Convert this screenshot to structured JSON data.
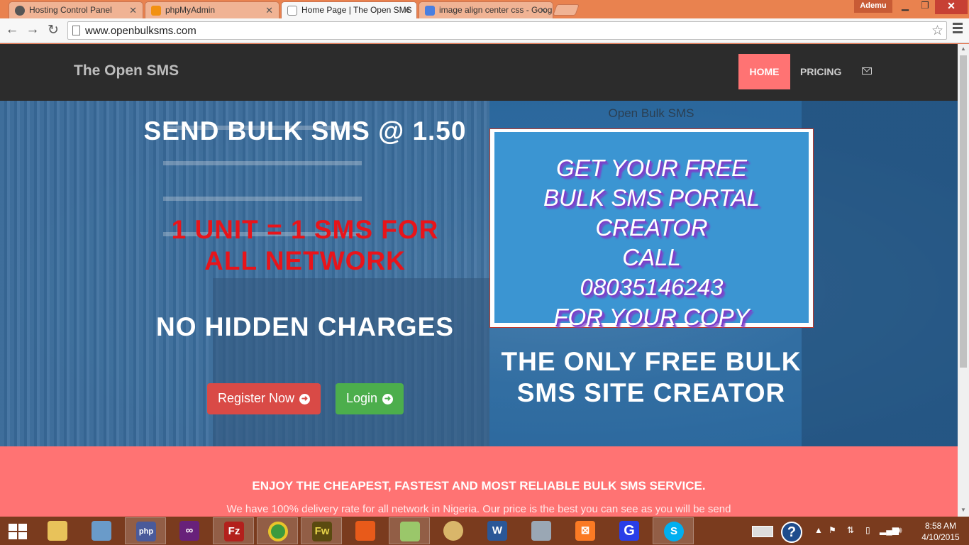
{
  "browser": {
    "tabs": [
      {
        "title": "Hosting Control Panel",
        "active": false
      },
      {
        "title": "phpMyAdmin",
        "active": false
      },
      {
        "title": "Home Page | The Open SMS",
        "active": true
      },
      {
        "title": "image align center css - Google Search",
        "active": false
      }
    ],
    "profile_name": "Ademu",
    "url": "www.openbulksms.com"
  },
  "site": {
    "brand": "The Open SMS",
    "nav": {
      "home": "HOME",
      "pricing": "PRICING"
    }
  },
  "hero": {
    "headline": "SEND BULK SMS @ 1.50",
    "unit_line": "1 UNIT = 1 SMS FOR ALL NETWORK",
    "no_hidden": "NO HIDDEN CHARGES",
    "register_label": "Register Now",
    "login_label": "Login",
    "promo_caption": "Open Bulk SMS",
    "promo_lines": [
      "GET YOUR FREE",
      "BULK SMS PORTAL CREATOR",
      "CALL",
      "08035146243",
      "FOR YOUR COPY"
    ],
    "only_free": "THE ONLY FREE BULK SMS SITE CREATOR"
  },
  "features": {
    "heading": "ENJOY THE CHEAPEST, FASTEST AND MOST RELIABLE BULK SMS SERVICE.",
    "text": "We have 100% delivery rate for all network in Nigeria. Our price is the best you can see as you will be send"
  },
  "taskbar": {
    "apps": [
      "file-explorer",
      "stack-app",
      "php-designer",
      "visual-studio",
      "filezilla",
      "chrome",
      "fireworks",
      "office-app",
      "notepad-plus",
      "paint",
      "word",
      "calculator",
      "xampp",
      "g-app",
      "skype"
    ],
    "time": "8:58 AM",
    "date": "4/10/2015"
  },
  "colors": {
    "accent_pink": "#ff7373",
    "nav_dark": "#2c2c2c",
    "register_red": "#d94a46",
    "login_green": "#4cae4c",
    "promo_blue": "#3b95d2"
  }
}
